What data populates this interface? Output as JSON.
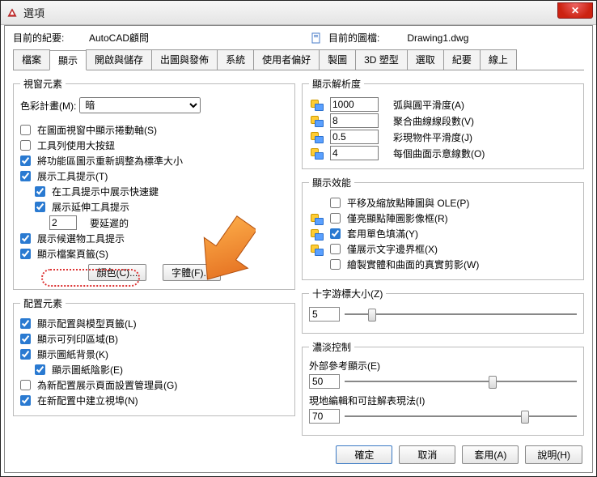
{
  "window": {
    "title": "選項"
  },
  "top": {
    "record_label": "目前的紀要:",
    "record_value": "AutoCAD顧問",
    "drawing_label": "目前的圖檔:",
    "drawing_value": "Drawing1.dwg"
  },
  "tabs": [
    "檔案",
    "顯示",
    "開啟與儲存",
    "出圖與發佈",
    "系統",
    "使用者偏好",
    "製圖",
    "3D 塑型",
    "選取",
    "紀要",
    "線上"
  ],
  "active_tab_index": 1,
  "left": {
    "group_window": "視窗元素",
    "color_scheme_label": "色彩計畫(M):",
    "color_scheme_value": "暗",
    "chk_scroll": "在圖面視窗中顯示捲動軸(S)",
    "chk_bigbtn": "工具列使用大按鈕",
    "chk_resize": "將功能區圖示重新調整為標準大小",
    "chk_tooltip": "展示工具提示(T)",
    "chk_tooltip_short": "在工具提示中展示快速鍵",
    "chk_tooltip_ext": "展示延伸工具提示",
    "ext_delay_value": "2",
    "ext_delay_label": "要延遲的",
    "chk_hover": "展示候選物工具提示",
    "chk_filetabs": "顯示檔案頁籤(S)",
    "btn_color": "顏色(C)...",
    "btn_font": "字體(F)...",
    "group_layout": "配置元素",
    "chk_layout_tabs": "顯示配置與模型頁籤(L)",
    "chk_printable": "顯示可列印區域(B)",
    "chk_paper_bg": "顯示圖紙背景(K)",
    "chk_paper_shadow": "顯示圖紙陰影(E)",
    "chk_pagesetup": "為新配置展示頁面設置管理員(G)",
    "chk_viewport": "在新配置中建立視埠(N)"
  },
  "right": {
    "group_res": "顯示解析度",
    "res1_value": "1000",
    "res1_label": "弧與圓平滑度(A)",
    "res2_value": "8",
    "res2_label": "聚合曲線線段數(V)",
    "res3_value": "0.5",
    "res3_label": "彩現物件平滑度(J)",
    "res4_value": "4",
    "res4_label": "每個曲面示意線數(O)",
    "group_perf": "顯示效能",
    "perf1": "平移及縮放點陣圖與 OLE(P)",
    "perf2": "僅亮顯點陣圖影像框(R)",
    "perf3": "套用單色填滿(Y)",
    "perf4": "僅展示文字邊界框(X)",
    "perf5": "繪製實體和曲面的真實剪影(W)",
    "group_cross": "十字游標大小(Z)",
    "cross_value": "5",
    "group_fade": "濃淡控制",
    "fade_xref_label": "外部參考顯示(E)",
    "fade_xref_value": "50",
    "fade_inplace_label": "現地編輯和可註解表現法(I)",
    "fade_inplace_value": "70"
  },
  "footer": {
    "ok": "確定",
    "cancel": "取消",
    "apply": "套用(A)",
    "help": "說明(H)"
  }
}
